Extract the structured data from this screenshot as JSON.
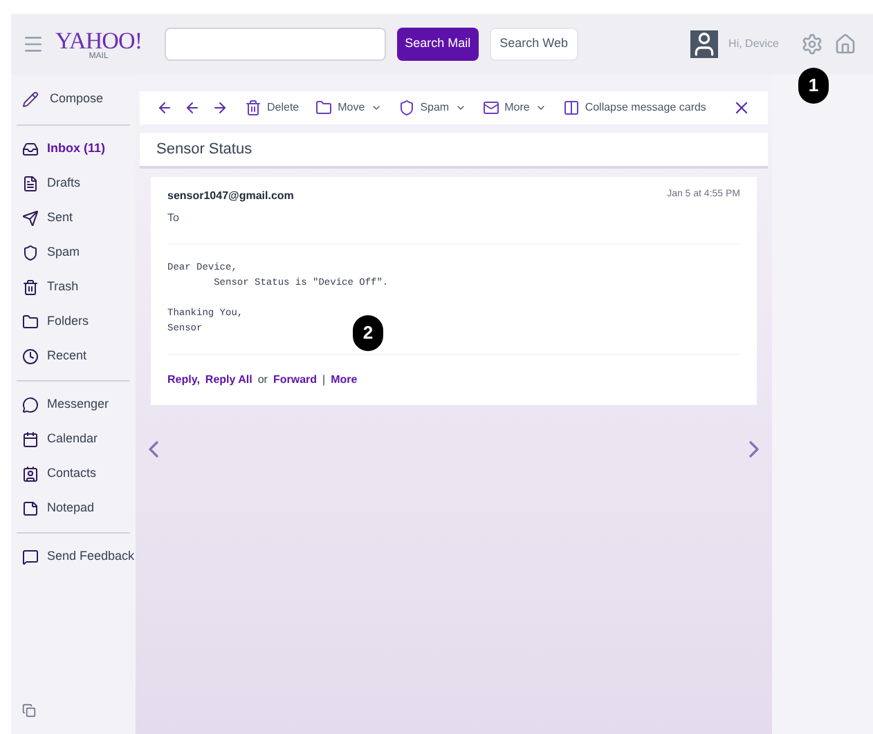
{
  "header": {
    "logo": "YAHOO!",
    "logo_sub": "MAIL",
    "search_mail": "Search Mail",
    "search_web": "Search Web",
    "user": "Hi, Device"
  },
  "sidebar": {
    "compose": "Compose",
    "groups": [
      {
        "items": [
          {
            "label": "Inbox (11)",
            "selected": true
          },
          {
            "label": "Drafts",
            "selected": false
          },
          {
            "label": "Sent",
            "selected": false
          },
          {
            "label": "Spam",
            "selected": false
          },
          {
            "label": "Trash",
            "selected": false
          },
          {
            "label": "Folders",
            "selected": false
          },
          {
            "label": "Recent",
            "selected": false
          }
        ]
      },
      {
        "items": [
          {
            "label": "Messenger",
            "selected": false
          },
          {
            "label": "Calendar",
            "selected": false
          },
          {
            "label": "Contacts",
            "selected": false
          },
          {
            "label": "Notepad",
            "selected": false
          }
        ]
      },
      {
        "items": [
          {
            "label": "Send Feedback",
            "selected": false
          }
        ]
      }
    ]
  },
  "toolbar": {
    "actions": [
      {
        "label": "Delete",
        "dropdown": false
      },
      {
        "label": "Move",
        "dropdown": true
      },
      {
        "label": "Spam",
        "dropdown": true
      },
      {
        "label": "More",
        "dropdown": true
      },
      {
        "label": "Collapse message cards",
        "dropdown": false
      }
    ]
  },
  "message": {
    "subject": "Sensor Status",
    "from": "sensor1047@gmail.com",
    "to": "To",
    "date": "Jan 5 at 4:55 PM",
    "body": [
      [
        "Dear Device,",
        "        Sensor Status is \"Device Off\"."
      ],
      [
        "Thanking You,",
        "Sensor"
      ]
    ],
    "actions": [
      {
        "kind": "link",
        "text": "Reply,"
      },
      {
        "kind": "link",
        "text": "Reply All"
      },
      {
        "kind": "text",
        "text": "or"
      },
      {
        "kind": "link",
        "text": "Forward"
      },
      {
        "kind": "text",
        "text": "|"
      },
      {
        "kind": "link",
        "text": "More"
      }
    ]
  },
  "callouts": [
    "1",
    "2"
  ]
}
